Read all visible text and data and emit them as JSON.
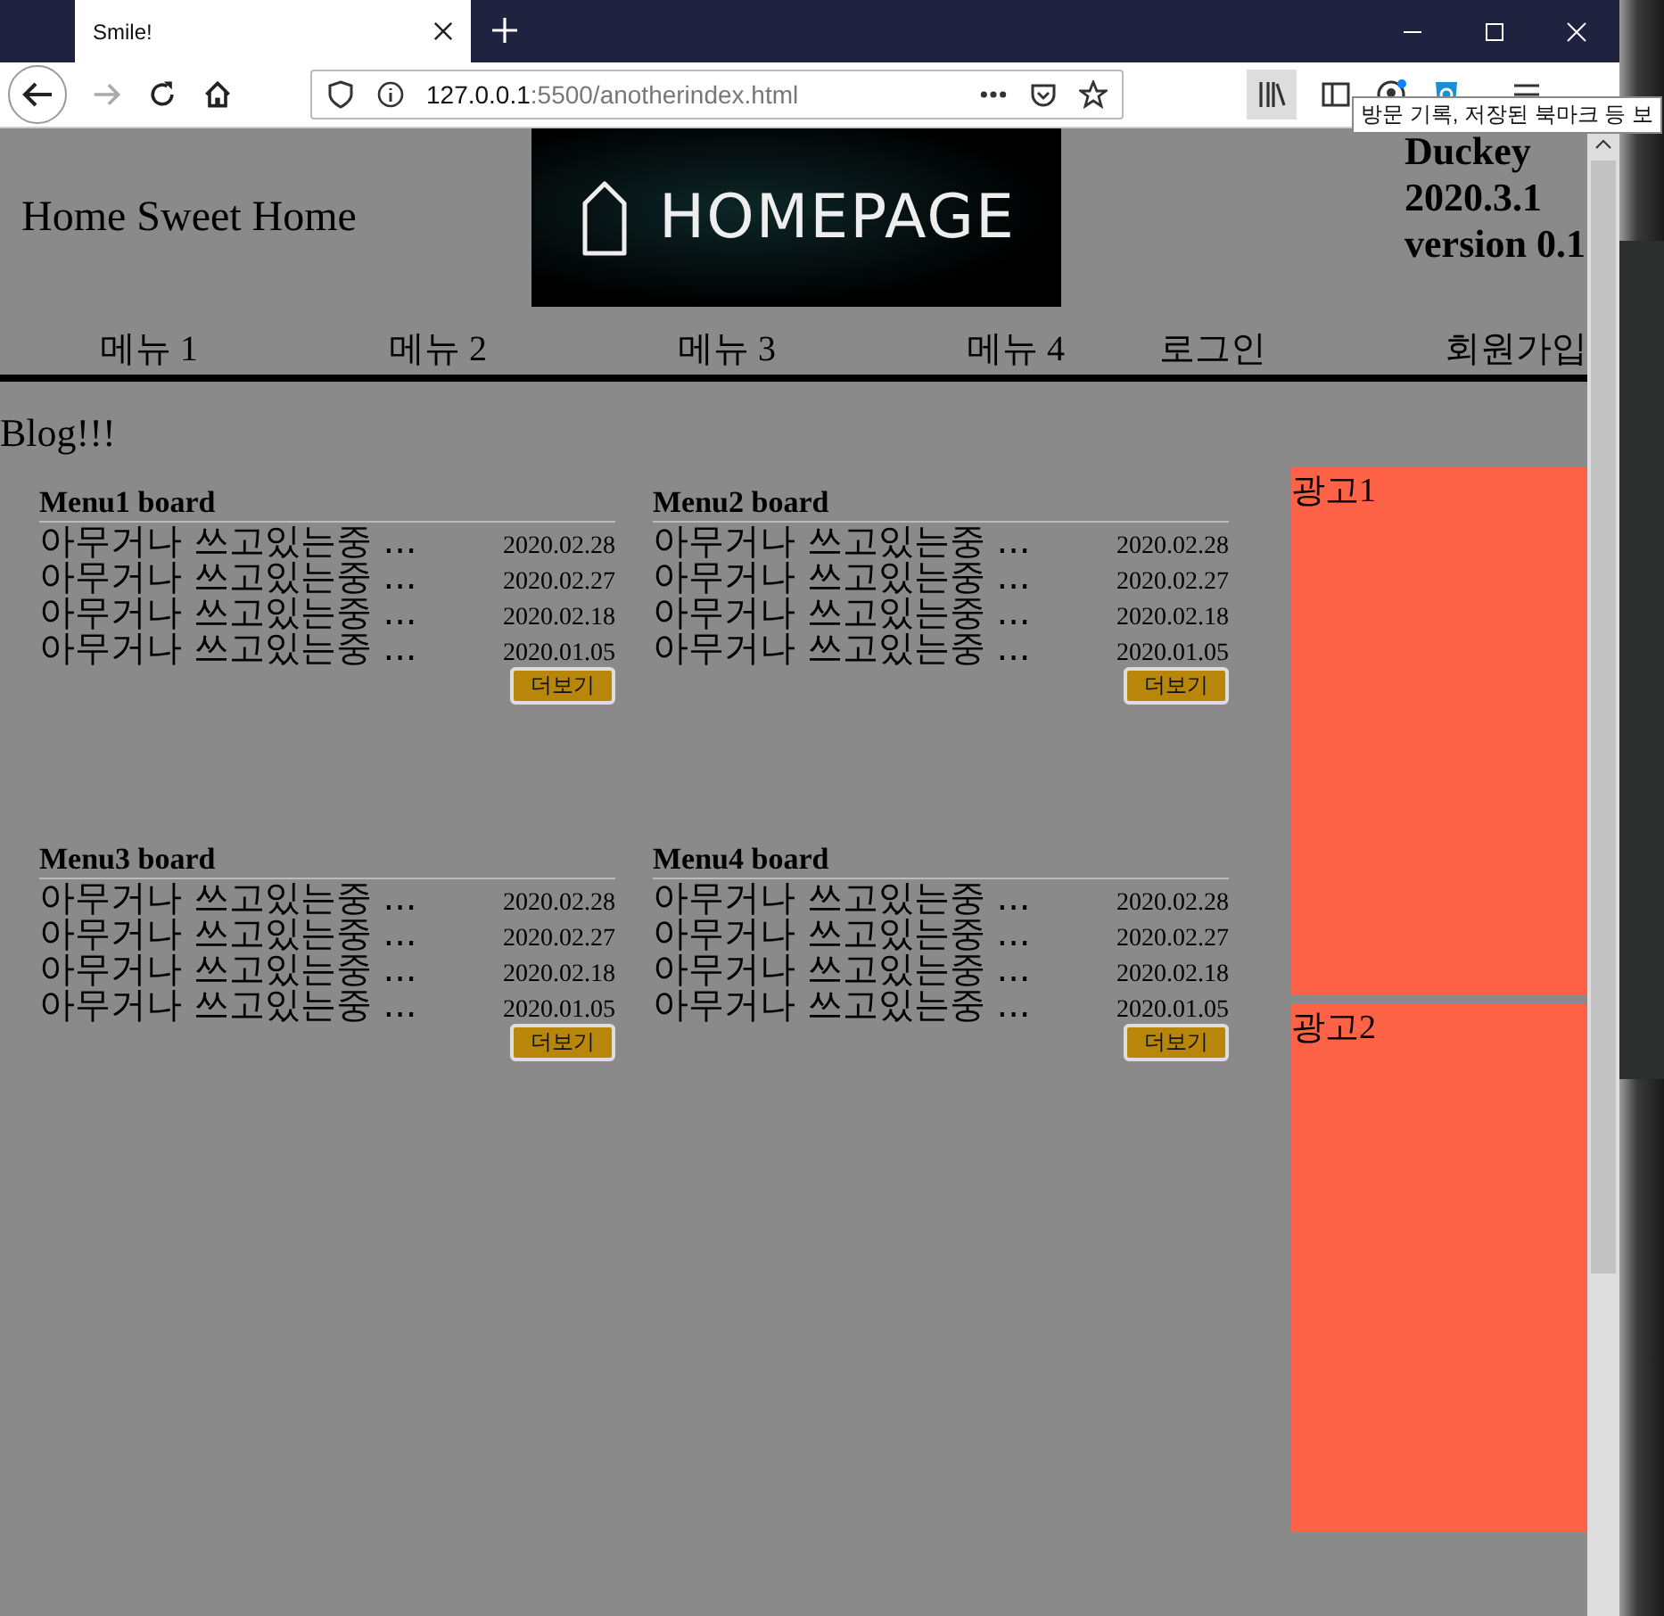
{
  "browser": {
    "tab": {
      "title": "Smile!",
      "selected": true
    },
    "url": {
      "host": "127.0.0.1",
      "rest": ":5500/anotherindex.html"
    },
    "tooltip": "방문 기록, 저장된 북마크 등 보"
  },
  "header": {
    "title": "Home Sweet Home",
    "logo_text": "HOMEPAGE",
    "info": [
      "Duckey",
      "2020.3.1",
      "version 0.1"
    ]
  },
  "nav": [
    "메뉴 1",
    "메뉴 2",
    "메뉴 3",
    "메뉴 4",
    "로그인",
    "회원가입"
  ],
  "blog_title": "Blog!!!",
  "boards": [
    {
      "title": "Menu1 board",
      "posts": [
        {
          "title": "아무거나 쓰고있는중 ...",
          "date": "2020.02.28"
        },
        {
          "title": "아무거나 쓰고있는중 ...",
          "date": "2020.02.27"
        },
        {
          "title": "아무거나 쓰고있는중 ...",
          "date": "2020.02.18"
        },
        {
          "title": "아무거나 쓰고있는중 ...",
          "date": "2020.01.05"
        }
      ],
      "more": "더보기"
    },
    {
      "title": "Menu2 board",
      "posts": [
        {
          "title": "아무거나 쓰고있는중 ...",
          "date": "2020.02.28"
        },
        {
          "title": "아무거나 쓰고있는중 ...",
          "date": "2020.02.27"
        },
        {
          "title": "아무거나 쓰고있는중 ...",
          "date": "2020.02.18"
        },
        {
          "title": "아무거나 쓰고있는중 ...",
          "date": "2020.01.05"
        }
      ],
      "more": "더보기"
    },
    {
      "title": "Menu3 board",
      "posts": [
        {
          "title": "아무거나 쓰고있는중 ...",
          "date": "2020.02.28"
        },
        {
          "title": "아무거나 쓰고있는중 ...",
          "date": "2020.02.27"
        },
        {
          "title": "아무거나 쓰고있는중 ...",
          "date": "2020.02.18"
        },
        {
          "title": "아무거나 쓰고있는중 ...",
          "date": "2020.01.05"
        }
      ],
      "more": "더보기"
    },
    {
      "title": "Menu4 board",
      "posts": [
        {
          "title": "아무거나 쓰고있는중 ...",
          "date": "2020.02.28"
        },
        {
          "title": "아무거나 쓰고있는중 ...",
          "date": "2020.02.27"
        },
        {
          "title": "아무거나 쓰고있는중 ...",
          "date": "2020.02.18"
        },
        {
          "title": "아무거나 쓰고있는중 ...",
          "date": "2020.01.05"
        }
      ],
      "more": "더보기"
    }
  ],
  "ads": [
    "광고1",
    "광고2"
  ]
}
